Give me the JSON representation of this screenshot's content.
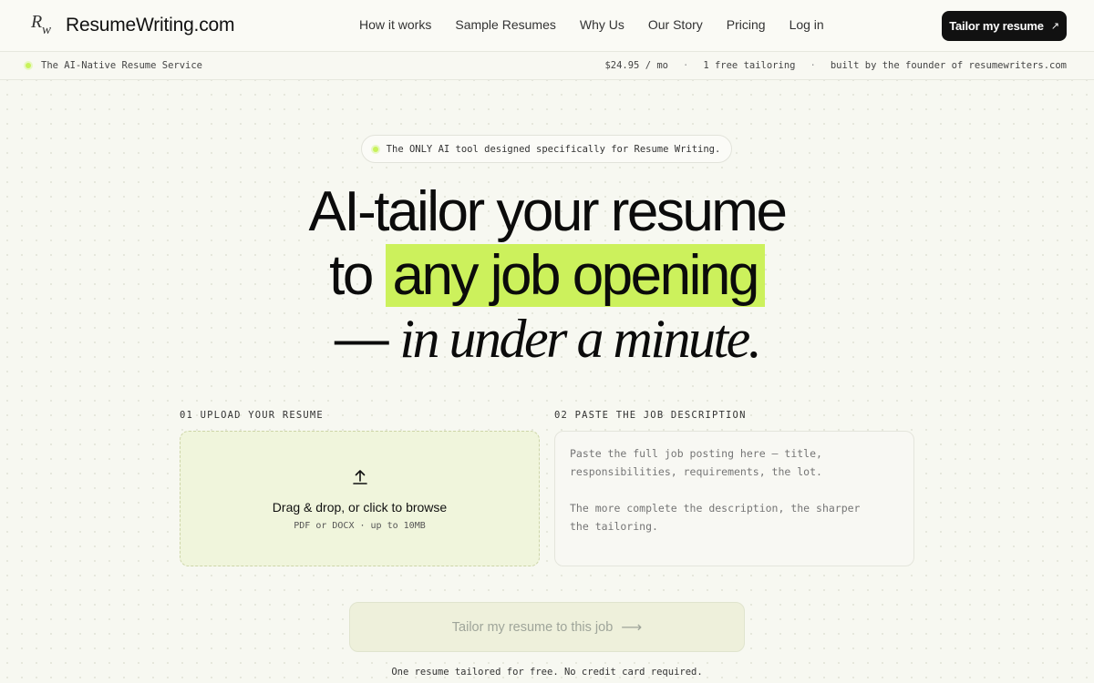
{
  "header": {
    "logo_letters_r": "R",
    "logo_letters_w": "w",
    "brand": "ResumeWriting.com",
    "nav": [
      "How it works",
      "Sample Resumes",
      "Why Us",
      "Our Story",
      "Pricing",
      "Log in"
    ],
    "cta_label": "Tailor my resume",
    "cta_arrow": "↗"
  },
  "subbar": {
    "tagline": "The AI-Native Resume Service",
    "price": "$24.95 / mo",
    "free": "1 free tailoring",
    "founder": "built by the founder of resumewriters.com",
    "separator": "·"
  },
  "hero": {
    "pill": "The ONLY AI tool designed specifically for Resume Writing.",
    "line1": "AI-tailor your resume",
    "line2_prefix": "to ",
    "line2_highlight": "any job opening",
    "line3_dash": "— ",
    "line3_italic": "in under a minute."
  },
  "steps": {
    "upload_label": "01 UPLOAD YOUR RESUME",
    "upload_main": "Drag & drop, or click to browse",
    "upload_sub": "PDF or DOCX · up to 10MB",
    "job_label": "02 PASTE THE JOB DESCRIPTION",
    "job_placeholder": "Paste the full job posting here — title,\nresponsibilities, requirements, the lot.\n\nThe more complete the description, the sharper\nthe tailoring."
  },
  "submit": {
    "label": "Tailor my resume to this job",
    "arrow": "⟶",
    "note": "One resume tailored for free. No credit card required."
  },
  "colors": {
    "accent": "#ccf15c",
    "background": "#f7f8f1",
    "dark": "#111111"
  },
  "icons": {
    "upload": "upload-icon",
    "status_dot": "status-dot-icon"
  }
}
